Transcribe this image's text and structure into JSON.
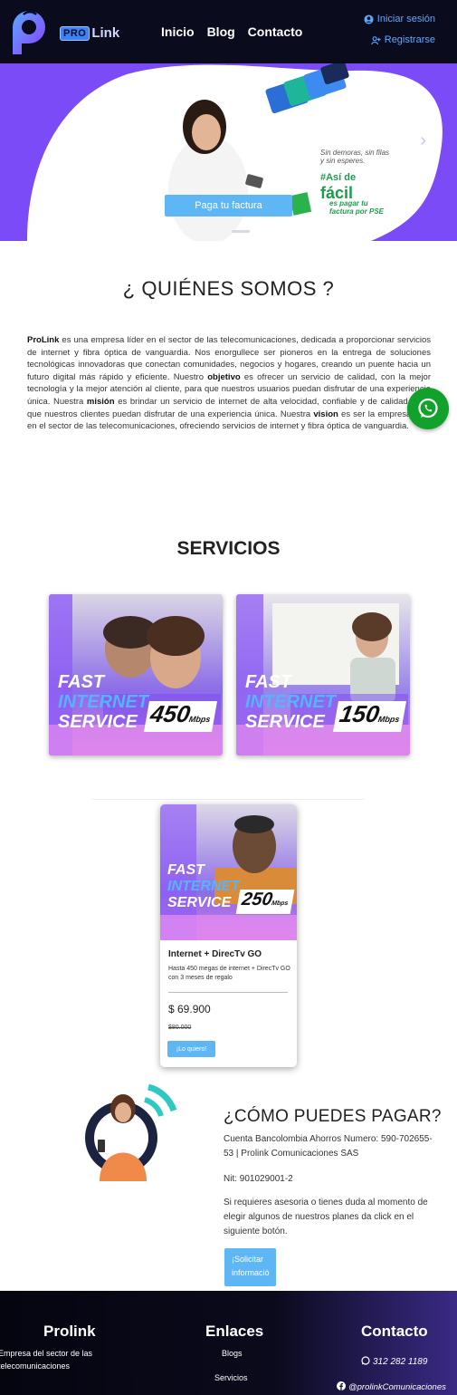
{
  "header": {
    "brand_pro": "PRO",
    "brand_link": "Link",
    "nav": [
      "Inicio",
      "Blog",
      "Contacto"
    ],
    "login": "Iniciar sesión",
    "register": "Registrarse"
  },
  "hero": {
    "pay_button": "Paga tu factura",
    "note": "Sin demoras, sin filas y sin esperes.",
    "facil_small": "#Así de",
    "facil": "fácil",
    "pse": "es pagar tu factura por PSE"
  },
  "about": {
    "title": "¿ QUIÉNES SOMOS ?",
    "brand": "ProLink",
    "p1": " es una empresa líder en el sector de las telecomunicaciones, dedicada a proporcionar servicios de internet y fibra óptica de vanguardia. Nos enorgullece ser pioneros en la entrega de soluciones tecnológicas innovadoras que conectan comunidades, negocios y hogares, creando un puente hacia un futuro digital más rápido y eficiente. Nuestro ",
    "objetivo": "objetivo",
    "p2": " es ofrecer un servicio de calidad, con la mejor tecnología y la mejor atención al cliente, para que nuestros usuarios puedan disfrutar de una experiencia única. Nuestra ",
    "mision": "misión",
    "p3": " es brindar un servicio de internet de alta velocidad, confiable y de calidad, para que nuestros clientes puedan disfrutar de una experiencia única. Nuestra ",
    "vision": "vision",
    "p4": " es ser la empresa líder en el sector de las telecomunicaciones, ofreciendo servicios de internet y fibra óptica de vanguardia."
  },
  "services": {
    "title": "SERVICIOS",
    "cards": [
      {
        "fast": "FAST",
        "internet": "INTERNET",
        "service": "SERVICE",
        "speed": "450",
        "unit": "Mbps"
      },
      {
        "fast": "FAST",
        "internet": "INTERNET",
        "service": "SERVICE",
        "speed": "150",
        "unit": "Mbps"
      }
    ],
    "product": {
      "fast": "FAST",
      "internet": "INTERNET",
      "service": "SERVICE",
      "speed": "250",
      "unit": "Mbps",
      "title": "Internet + DirecTv GO",
      "desc": "Hasta 450 megas de internet + DirecTv GO con 3 meses de regalo",
      "price": "$ 69.900",
      "old_price": "$80.000",
      "button": "¡Lo quiero!"
    }
  },
  "payment": {
    "title": "¿CÓMO PUEDES PAGAR?",
    "account": "Cuenta Bancolombia Ahorros Numero: 590-702655-53 | Prolink Comunicaciones SAS",
    "nit": "Nit: 901029001-2",
    "help": "Si requieres asesoria o tienes duda al momento de elegir algunos de nuestros planes da click en el siguiente botón.",
    "button_line1": "¡Solicitar",
    "button_line2": "informació"
  },
  "footer": {
    "col1_title": "Prolink",
    "col1_line1": "Empresa del sector de las",
    "col1_line2": "telecomunicaciones",
    "col2_title": "Enlaces",
    "links": [
      "Blogs",
      "Servicios"
    ],
    "col3_title": "Contacto",
    "phone": "312 282 1189",
    "facebook": "@prolinkComunicaciones"
  },
  "colors": {
    "header_bg": "#0b0b1e",
    "accent_blue": "#5fb6f4",
    "hero_purple": "#7b4bf7",
    "whatsapp_green": "#12a12a"
  }
}
